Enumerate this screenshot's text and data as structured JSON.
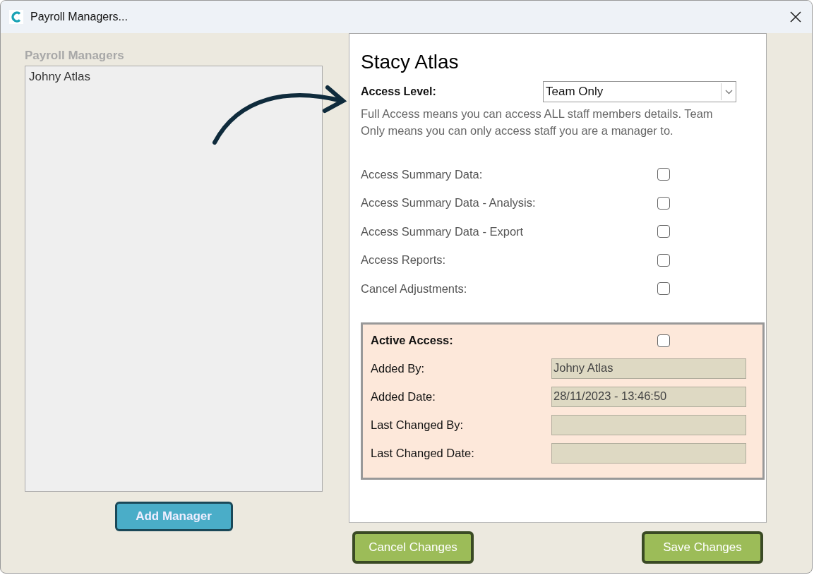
{
  "window": {
    "title": "Payroll Managers..."
  },
  "managers": {
    "label": "Payroll Managers",
    "items": [
      {
        "name": "Johny Atlas",
        "selected": false
      }
    ],
    "add_button": "Add Manager"
  },
  "detail": {
    "name": "Stacy Atlas",
    "access_level": {
      "label": "Access Level:",
      "value": "Team Only"
    },
    "description": "Full Access means you can access ALL staff members details.  Team Only means you can only access staff you are a manager to.",
    "permissions": [
      {
        "label": "Access Summary Data:",
        "checked": false
      },
      {
        "label": "Access Summary Data - Analysis:",
        "checked": false
      },
      {
        "label": "Access Summary Data - Export",
        "checked": false
      },
      {
        "label": "Access Reports:",
        "checked": false
      },
      {
        "label": "Cancel Adjustments:",
        "checked": false
      }
    ],
    "audit": {
      "active": {
        "label": "Active Access:",
        "checked": false
      },
      "fields": [
        {
          "label": "Added By:",
          "value": "Johny Atlas"
        },
        {
          "label": "Added Date:",
          "value": "28/11/2023 - 13:46:50"
        },
        {
          "label": "Last Changed By:"
        },
        {
          "label": "Last Changed Date:"
        }
      ]
    }
  },
  "footer": {
    "cancel_button": "Cancel Changes",
    "save_button": "Save Changes"
  }
}
